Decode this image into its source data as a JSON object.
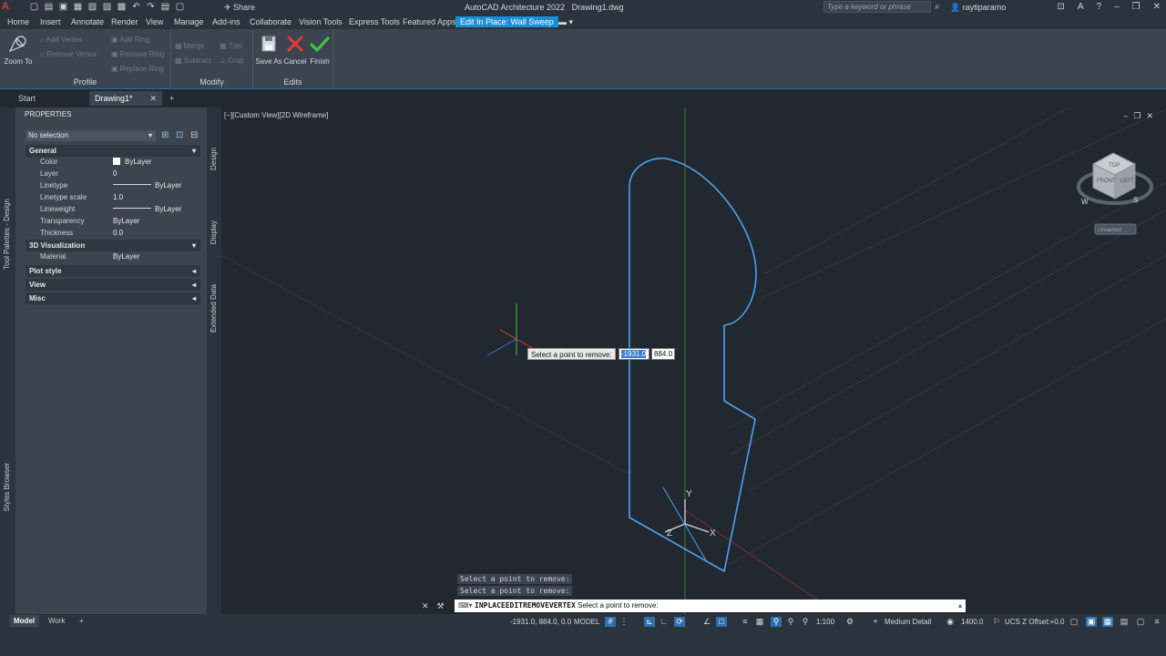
{
  "app": {
    "title": "AutoCAD Architecture 2022",
    "file": "Drawing1.dwg",
    "share_label": "Share",
    "search_placeholder": "Type a keyword or phrase",
    "user": "raytiparamo"
  },
  "menu": {
    "tabs": [
      "Home",
      "Insert",
      "Annotate",
      "Render",
      "View",
      "Manage",
      "Add-ins",
      "Collaborate",
      "Vision Tools",
      "Express Tools",
      "Featured Apps",
      "Edit In Place: Wall Sweep"
    ]
  },
  "ribbon": {
    "profile": {
      "title": "Profile",
      "zoom_to": "Zoom To",
      "add_vertex": "Add Vertex",
      "remove_vertex": "Remove Vertex",
      "add_ring": "Add Ring",
      "remove_ring": "Remove Ring",
      "replace_ring": "Replace Ring"
    },
    "modify": {
      "title": "Modify",
      "merge": "Merge",
      "trim": "Trim",
      "subtract": "Subtract",
      "crop": "Crop"
    },
    "edits": {
      "title": "Edits",
      "save_as": "Save As",
      "cancel": "Cancel",
      "finish": "Finish"
    }
  },
  "doc_tabs": {
    "start": "Start",
    "drawing": "Drawing1*"
  },
  "left_strip": {
    "tool_palettes": "Tool Palettes - Design",
    "styles_browser": "Styles Browser"
  },
  "properties": {
    "header": "PROPERTIES",
    "selection": "No selection",
    "general": {
      "title": "General",
      "rows": [
        {
          "key": "Color",
          "value": "ByLayer"
        },
        {
          "key": "Layer",
          "value": "0"
        },
        {
          "key": "Linetype",
          "value": "ByLayer"
        },
        {
          "key": "Linetype scale",
          "value": "1.0"
        },
        {
          "key": "Lineweight",
          "value": "ByLayer"
        },
        {
          "key": "Transparency",
          "value": "ByLayer"
        },
        {
          "key": "Thickness",
          "value": "0.0"
        }
      ]
    },
    "viz": {
      "title": "3D Visualization",
      "material_key": "Material",
      "material_value": "ByLayer"
    },
    "sections": [
      "Plot style",
      "View",
      "Misc"
    ],
    "side_tabs": [
      "Design",
      "Display",
      "Extended Data"
    ]
  },
  "viewport": {
    "label": "[−][Custom View][2D Wireframe]",
    "prompt": "Select a point to remove:",
    "coord_x": "-1931.0",
    "coord_y": "884.0",
    "viewcube_top": "TOP",
    "viewcube_front": "FRONT",
    "viewcube_left": "LEFT",
    "compass_s": "S",
    "compass_w": "W",
    "ucs_name": "Unnamed",
    "axis_y": "Y",
    "axis_x": "X",
    "axis_z": "Z"
  },
  "command": {
    "history": [
      "Select a point to remove:",
      "Select a point to remove:"
    ],
    "current_cmd": "INPLACEEDITREMOVEVERTEX",
    "current_prompt": "Select a point to remove:"
  },
  "status": {
    "tab_model": "Model",
    "tab_work": "Work",
    "coords": "-1931.0, 884.0, 0.0",
    "space": "MODEL",
    "scale": "1:100",
    "detail": "Medium Detail",
    "elevation": "1400.0",
    "ucs_offset": "UCS Z Offset:+0.0"
  },
  "colors": {
    "accent": "#1a8fd8",
    "profile_line": "#4aa3f0",
    "cancel_red": "#e53935",
    "finish_green": "#43c04a"
  }
}
